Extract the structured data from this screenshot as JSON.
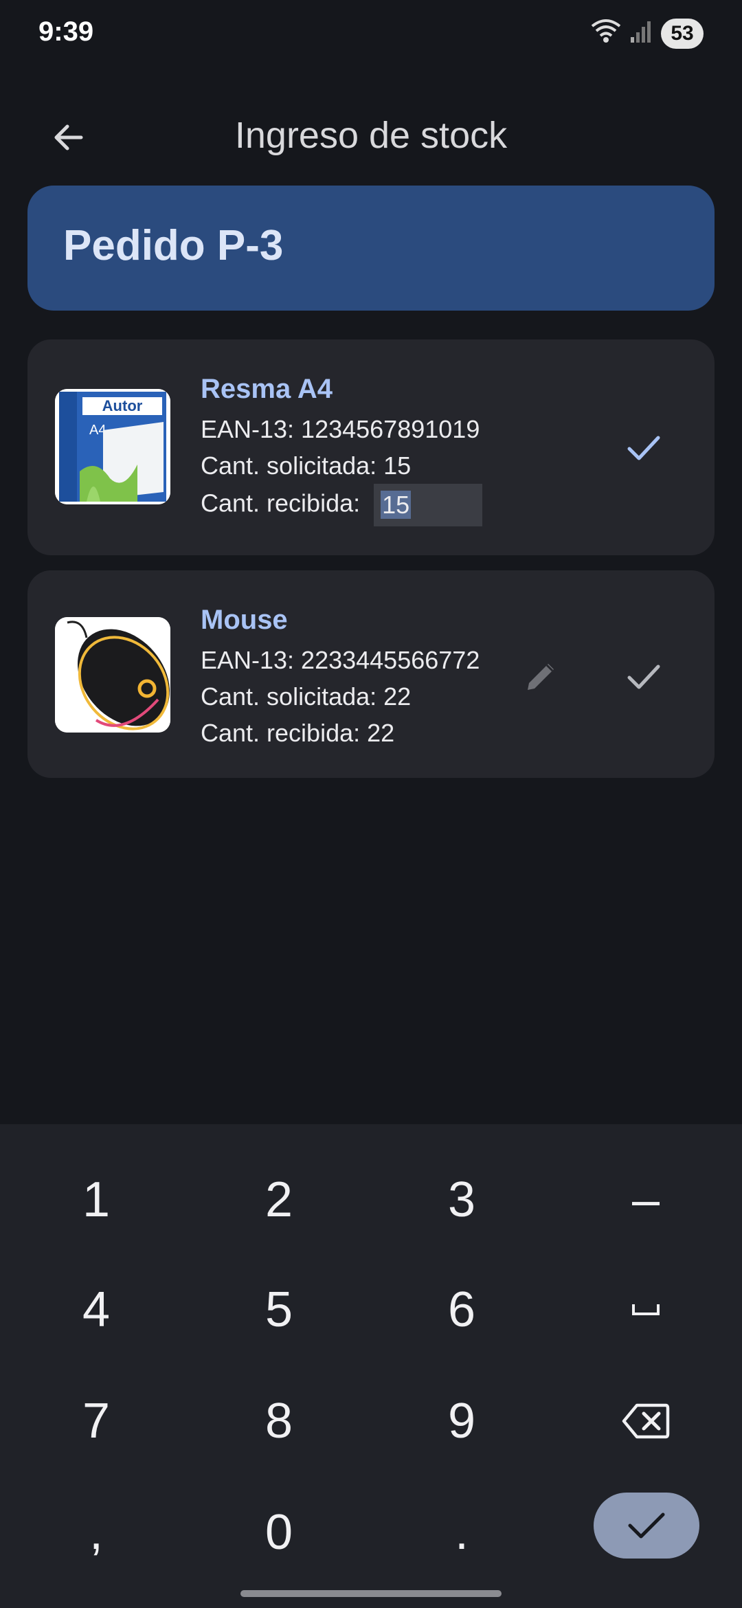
{
  "status": {
    "time": "9:39",
    "battery": "53",
    "wifi_badge": "5"
  },
  "app_bar": {
    "title": "Ingreso de stock"
  },
  "order": {
    "title": "Pedido P-3"
  },
  "products": [
    {
      "name": "Resma A4",
      "ean": "EAN-13: 1234567891019",
      "requested": "Cant. solicitada: 15",
      "received_label": "Cant. recibida:",
      "received_value": "15",
      "thumb_brand": "Autor",
      "thumb_size": "A4"
    },
    {
      "name": "Mouse",
      "ean": "EAN-13: 2233445566772",
      "requested": "Cant. solicitada: 22",
      "received": "Cant. recibida: 22"
    }
  ],
  "keyboard": {
    "keys": [
      "1",
      "2",
      "3",
      "–",
      "4",
      "5",
      "6",
      "␣",
      "7",
      "8",
      "9",
      "⌫",
      ",",
      "0",
      "."
    ]
  },
  "colors": {
    "accent": "#a9c3f5",
    "order_bg": "#2b4b7e",
    "card_bg": "#25262c"
  }
}
